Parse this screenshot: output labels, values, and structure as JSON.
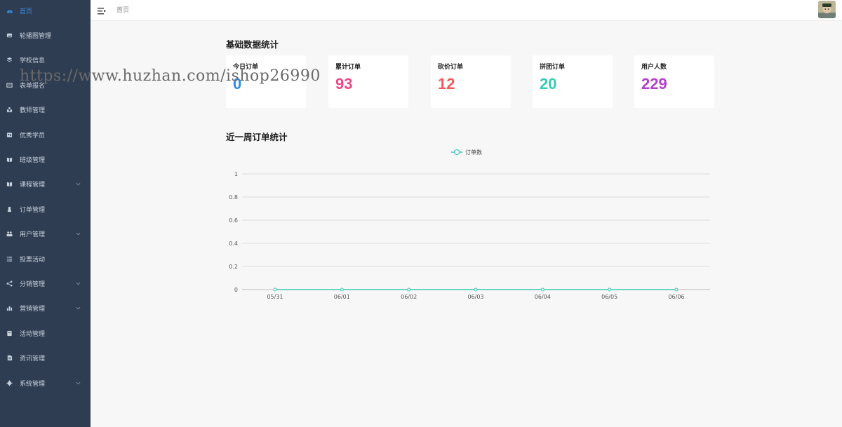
{
  "sidebar": {
    "items": [
      {
        "label": "首页",
        "icon": "dashboard-icon",
        "active": true,
        "expandable": false
      },
      {
        "label": "轮播图管理",
        "icon": "image-icon",
        "active": false,
        "expandable": false
      },
      {
        "label": "学校信息",
        "icon": "layers-icon",
        "active": false,
        "expandable": false
      },
      {
        "label": "表单报名",
        "icon": "form-icon",
        "active": false,
        "expandable": false
      },
      {
        "label": "教师管理",
        "icon": "team-icon",
        "active": false,
        "expandable": false
      },
      {
        "label": "优秀学员",
        "icon": "id-card-icon",
        "active": false,
        "expandable": false
      },
      {
        "label": "班级管理",
        "icon": "book-icon",
        "active": false,
        "expandable": false
      },
      {
        "label": "课程管理",
        "icon": "book-icon",
        "active": false,
        "expandable": true
      },
      {
        "label": "订单管理",
        "icon": "order-icon",
        "active": false,
        "expandable": false
      },
      {
        "label": "用户管理",
        "icon": "users-icon",
        "active": false,
        "expandable": true
      },
      {
        "label": "投票活动",
        "icon": "list-icon",
        "active": false,
        "expandable": false
      },
      {
        "label": "分销管理",
        "icon": "share-icon",
        "active": false,
        "expandable": true
      },
      {
        "label": "营销管理",
        "icon": "bar-chart-icon",
        "active": false,
        "expandable": true
      },
      {
        "label": "活动管理",
        "icon": "flag-icon",
        "active": false,
        "expandable": false
      },
      {
        "label": "资讯管理",
        "icon": "document-icon",
        "active": false,
        "expandable": false
      },
      {
        "label": "系统管理",
        "icon": "gear-icon",
        "active": false,
        "expandable": true
      }
    ]
  },
  "header": {
    "breadcrumb": "首页",
    "menu_icon": "menu-fold-icon",
    "avatar_icon": "user-avatar"
  },
  "stats": {
    "title": "基础数据统计",
    "cards": [
      {
        "label": "今日订单",
        "value": "0",
        "color": "#2f8de4"
      },
      {
        "label": "累计订单",
        "value": "93",
        "color": "#ea4a87"
      },
      {
        "label": "砍价订单",
        "value": "12",
        "color": "#ee5a5f"
      },
      {
        "label": "拼团订单",
        "value": "20",
        "color": "#3cc8b4"
      },
      {
        "label": "用户人数",
        "value": "229",
        "color": "#b43fcf"
      }
    ]
  },
  "chart_section": {
    "title": "近一周订单统计"
  },
  "chart_data": {
    "type": "line",
    "categories": [
      "05/31",
      "06/01",
      "06/02",
      "06/03",
      "06/04",
      "06/05",
      "06/06"
    ],
    "series": [
      {
        "name": "订单数",
        "values": [
          0,
          0,
          0,
          0,
          0,
          0,
          0
        ],
        "color": "#3cc8b4"
      }
    ],
    "y_ticks": [
      "0",
      "0.2",
      "0.4",
      "0.6",
      "0.8",
      "1"
    ],
    "ylim": [
      0,
      1
    ],
    "grid": true,
    "legend_position": "top-center"
  },
  "watermark": {
    "text": "https://www.huzhan.com/ishop26990"
  }
}
